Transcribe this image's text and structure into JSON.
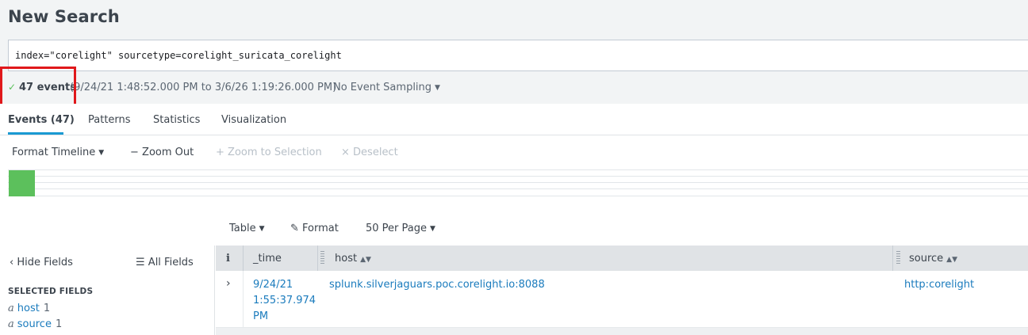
{
  "page_title": "New Search",
  "search": {
    "query": "index=\"corelight\" sourcetype=corelight_suricata_corelight"
  },
  "status": {
    "check_icon": "check-icon",
    "events_label": "47 events",
    "time_range": "(9/24/21 1:48:52.000 PM to 3/6/26 1:19:26.000 PM)",
    "sampling": "No Event Sampling"
  },
  "tabs": [
    {
      "label": "Events (47)",
      "active": true
    },
    {
      "label": "Patterns",
      "active": false
    },
    {
      "label": "Statistics",
      "active": false
    },
    {
      "label": "Visualization",
      "active": false
    }
  ],
  "timeline": {
    "format_label": "Format Timeline",
    "zoom_out": "Zoom Out",
    "zoom_selection": "Zoom to Selection",
    "deselect": "Deselect"
  },
  "results_toolbar": {
    "table": "Table",
    "format": "Format",
    "per_page": "50 Per Page"
  },
  "fields_panel": {
    "hide_fields": "Hide Fields",
    "all_fields": "All Fields",
    "selected_heading": "SELECTED FIELDS",
    "fields": [
      {
        "type": "a",
        "name": "host",
        "count": "1"
      },
      {
        "type": "a",
        "name": "source",
        "count": "1"
      }
    ]
  },
  "table": {
    "info_header": "i",
    "columns": [
      "_time",
      "host",
      "source"
    ],
    "rows": [
      {
        "time_date": "9/24/21",
        "time_clock": "1:55:37.974",
        "time_ampm": "PM",
        "host": "splunk.silverjaguars.poc.corelight.io:8088",
        "source": "http:corelight"
      }
    ]
  },
  "colors": {
    "accent": "#1a9ad2",
    "link": "#1a7bbd",
    "success": "#5cc05c",
    "highlight": "#e0181b"
  }
}
